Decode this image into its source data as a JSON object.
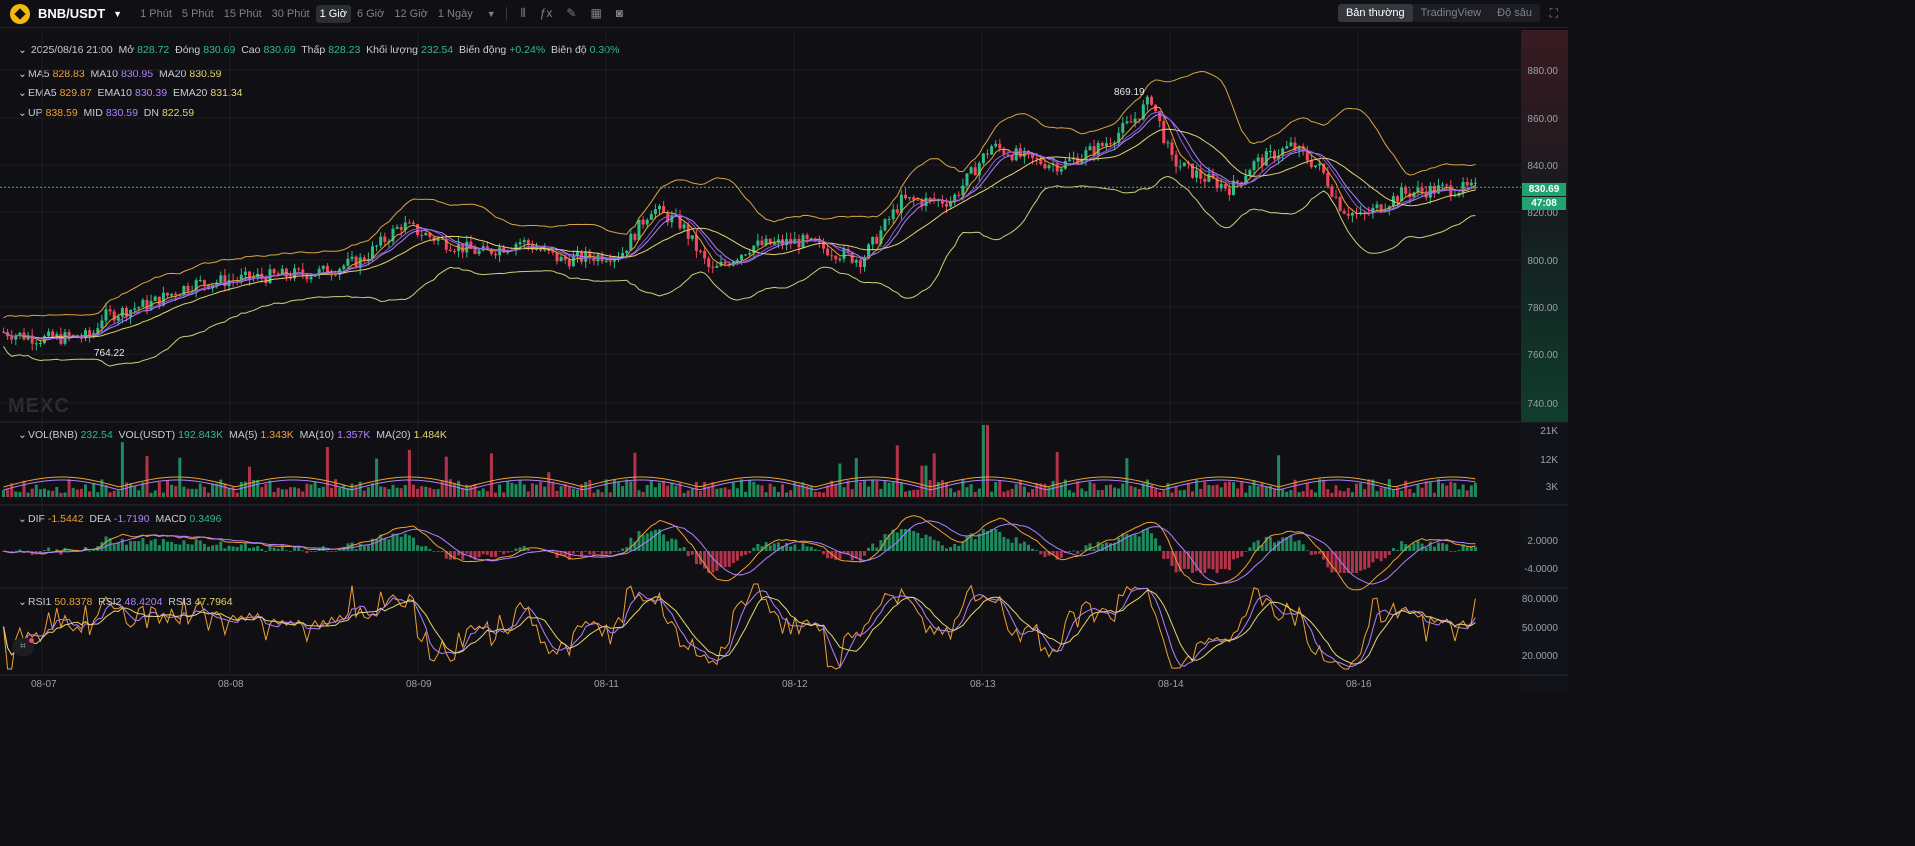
{
  "header": {
    "pair": "BNB/USDT",
    "timeframes": [
      "1 Phút",
      "5 Phút",
      "15 Phút",
      "30 Phút",
      "1 Giờ",
      "6 Giờ",
      "12 Giờ",
      "1 Ngày"
    ],
    "active_timeframe_index": 4,
    "views": [
      "Bản thường",
      "TradingView",
      "Độ sâu"
    ],
    "active_view_index": 0
  },
  "ohlc": {
    "date": "2025/08/16 21:00",
    "open_label": "Mở",
    "open": "828.72",
    "close_label": "Đóng",
    "close": "830.69",
    "high_label": "Cao",
    "high": "830.69",
    "low_label": "Thấp",
    "low": "828.23",
    "vol_label": "Khối lượng",
    "vol": "232.54",
    "chg_label": "Biến động",
    "chg": "+0.24%",
    "amp_label": "Biên độ",
    "amp": "0.30%"
  },
  "ma": {
    "ma5": "828.83",
    "ma10": "830.95",
    "ma20": "830.59"
  },
  "ema": {
    "ema5": "829.87",
    "ema10": "830.39",
    "ema20": "831.34"
  },
  "boll": {
    "up": "838.59",
    "mid": "830.59",
    "dn": "822.59"
  },
  "vol_legend": {
    "vol_bnb": "232.54",
    "vol_usdt": "192.843K",
    "ma5": "1.343K",
    "ma10": "1.357K",
    "ma20": "1.484K"
  },
  "macd_legend": {
    "dif": "-1.5442",
    "dea": "-1.7190",
    "macd": "0.3496"
  },
  "rsi_legend": {
    "rsi1": "50.8378",
    "rsi2": "48.4204",
    "rsi3": "47.7964"
  },
  "price_axis": [
    "880.00",
    "860.00",
    "840.00",
    "820.00",
    "800.00",
    "780.00",
    "760.00",
    "740.00"
  ],
  "vol_axis": [
    "21K",
    "12K",
    "3K"
  ],
  "macd_axis": [
    "2.0000",
    "-4.0000"
  ],
  "rsi_axis": [
    "80.0000",
    "50.0000",
    "20.0000"
  ],
  "price_tag": {
    "price": "830.69",
    "countdown": "47:08"
  },
  "high_marker": "869.19",
  "low_marker": "764.22",
  "watermark": "MEXC",
  "dates": [
    "08-07",
    "08-08",
    "08-09",
    "08-11",
    "08-12",
    "08-13",
    "08-14",
    "08-16"
  ],
  "colors": {
    "up": "#2ebd85",
    "down": "#f6465d",
    "ma5": "#f0a030",
    "ma10": "#b080ff",
    "ma20": "#e6d46a"
  },
  "chart_data": {
    "type": "line",
    "price_keypoints": [
      [
        0,
        770
      ],
      [
        40,
        767
      ],
      [
        90,
        768
      ],
      [
        100,
        776
      ],
      [
        150,
        782
      ],
      [
        190,
        790
      ],
      [
        260,
        793
      ],
      [
        320,
        795
      ],
      [
        360,
        800
      ],
      [
        400,
        815
      ],
      [
        440,
        808
      ],
      [
        480,
        803
      ],
      [
        520,
        808
      ],
      [
        560,
        800
      ],
      [
        620,
        803
      ],
      [
        650,
        822
      ],
      [
        680,
        815
      ],
      [
        710,
        795
      ],
      [
        750,
        806
      ],
      [
        800,
        808
      ],
      [
        860,
        800
      ],
      [
        900,
        825
      ],
      [
        950,
        825
      ],
      [
        990,
        848
      ],
      [
        1030,
        842
      ],
      [
        1060,
        840
      ],
      [
        1100,
        848
      ],
      [
        1130,
        858
      ],
      [
        1150,
        868
      ],
      [
        1170,
        842
      ],
      [
        1200,
        835
      ],
      [
        1230,
        830
      ],
      [
        1250,
        840
      ],
      [
        1290,
        848
      ],
      [
        1320,
        838
      ],
      [
        1340,
        822
      ],
      [
        1360,
        818
      ],
      [
        1400,
        828
      ],
      [
        1440,
        830
      ],
      [
        1476,
        830
      ]
    ],
    "ylim": [
      740,
      890
    ]
  }
}
